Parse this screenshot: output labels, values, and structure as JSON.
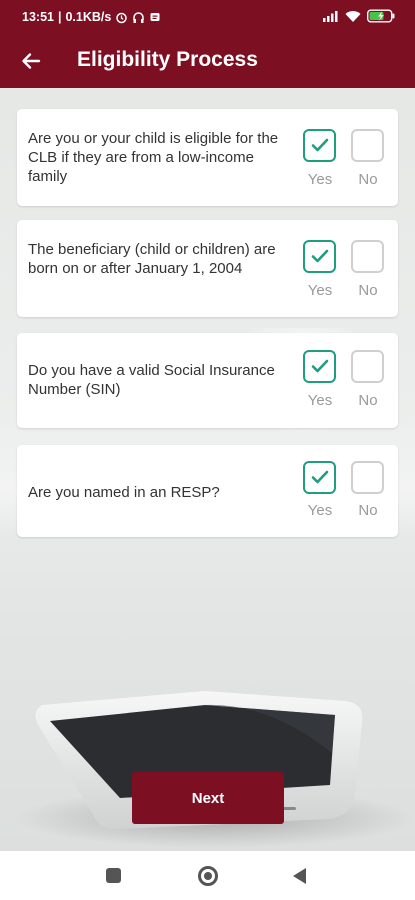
{
  "status_bar": {
    "time": "13:51",
    "speed": "0.1KB/s",
    "battery": "",
    "icons": [
      "alarm-icon",
      "headphones-icon",
      "notification-icon",
      "signal-icon",
      "wifi-icon",
      "battery-icon"
    ]
  },
  "app_bar": {
    "title": "Eligibility Process",
    "back_icon": "arrow-left-icon"
  },
  "questions": [
    {
      "text": "Are you or your child is eligible for the CLB if they are from a low-income family",
      "yes_label": "Yes",
      "no_label": "No",
      "selected": "yes"
    },
    {
      "text": "The beneficiary (child or children) are born on or after January 1, 2004",
      "yes_label": "Yes",
      "no_label": "No",
      "selected": "yes"
    },
    {
      "text": "Do you have a valid Social Insurance Number (SIN)",
      "yes_label": "Yes",
      "no_label": "No",
      "selected": "yes"
    },
    {
      "text": "Are you named in an RESP?",
      "yes_label": "Yes",
      "no_label": "No",
      "selected": "yes"
    }
  ],
  "next_button": {
    "label": "Next"
  },
  "colors": {
    "brand": "#7d0f23",
    "check": "#1f9d7f"
  },
  "nav": {
    "icons": [
      "recents-square-icon",
      "home-circle-icon",
      "back-triangle-icon"
    ]
  }
}
